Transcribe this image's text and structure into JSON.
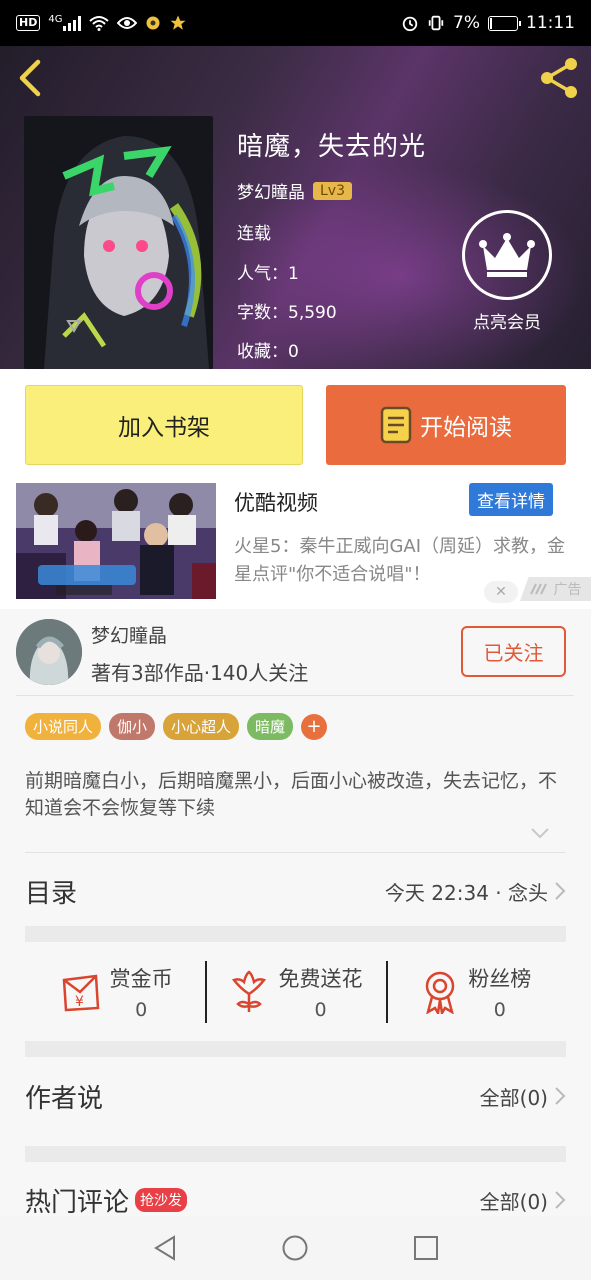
{
  "status_bar": {
    "hd": "HD",
    "network": "4G",
    "battery": "7%",
    "battery_level": 0.07,
    "time": "11:11"
  },
  "book": {
    "title": "暗魔，失去的光",
    "author": "梦幻瞳晶",
    "author_level": "Lv3",
    "status": "连载",
    "popularity": "人气：1",
    "word_count": "字数：5,590",
    "favorites": "收藏：0",
    "vip_label": "点亮会员"
  },
  "actions": {
    "add_shelf": "加入书架",
    "start_read": "开始阅读"
  },
  "ad": {
    "brand": "优酷视频",
    "detail_btn": "查看详情",
    "desc": "火星5：秦牛正威向GAI（周延）求教，金星点评\"你不适合说唱\"！",
    "close": "✕",
    "label": "广告"
  },
  "author": {
    "name": "梦幻瞳晶",
    "stats": "著有3部作品·140人关注",
    "follow_btn": "已关注"
  },
  "tags": [
    {
      "label": "小说同人",
      "color": "#f0b23c"
    },
    {
      "label": "伽小",
      "color": "#c0786a"
    },
    {
      "label": "小心超人",
      "color": "#d8a43a"
    },
    {
      "label": "暗魔",
      "color": "#7dbb63"
    }
  ],
  "tag_add": "+",
  "description": "前期暗魔白小，后期暗魔黑小，后面小心被改造，失去记忆，不知道会不会恢复等下续",
  "catalog": {
    "title": "目录",
    "latest": "今天 22:34 · 念头"
  },
  "rewards": [
    {
      "label": "赏金币",
      "value": "0",
      "icon": "red-envelope-icon"
    },
    {
      "label": "免费送花",
      "value": "0",
      "icon": "flower-icon"
    },
    {
      "label": "粉丝榜",
      "value": "0",
      "icon": "medal-icon"
    }
  ],
  "author_says": {
    "title": "作者说",
    "all": "全部(0)"
  },
  "hot_comments": {
    "title": "热门评论",
    "badge": "抢沙发",
    "all": "全部(0)"
  },
  "colors": {
    "accent_orange": "#ea6c3e",
    "shelf_yellow": "#fbef7c",
    "follow_red": "#e05a3a",
    "ad_blue": "#2f7ad8"
  }
}
